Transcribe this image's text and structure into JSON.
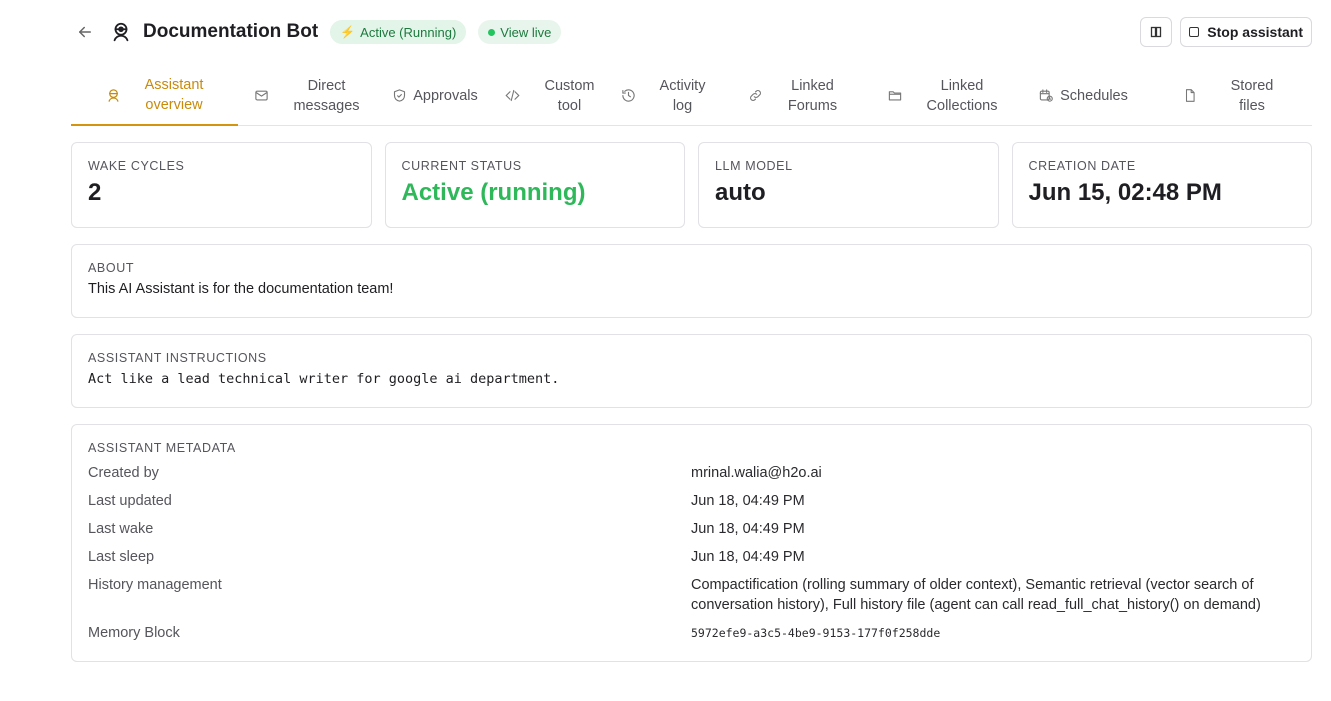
{
  "header": {
    "title": "Documentation Bot",
    "status_pill": "Active (Running)",
    "view_live": "View live",
    "stop_label": "Stop assistant"
  },
  "tabs": [
    {
      "label": "Assistant\noverview",
      "icon": "robot-icon",
      "active": true
    },
    {
      "label": "Direct\nmessages",
      "icon": "mail-icon"
    },
    {
      "label": "Approvals",
      "icon": "shield-check-icon"
    },
    {
      "label": "Custom\ntool",
      "icon": "code-icon"
    },
    {
      "label": "Activity\nlog",
      "icon": "history-icon"
    },
    {
      "label": "Linked\nForums",
      "icon": "link-icon"
    },
    {
      "label": "Linked\nCollections",
      "icon": "folder-icon"
    },
    {
      "label": "Schedules",
      "icon": "calendar-clock-icon"
    },
    {
      "label": "Stored\nfiles",
      "icon": "file-icon"
    }
  ],
  "stats": [
    {
      "label": "WAKE CYCLES",
      "value": "2"
    },
    {
      "label": "CURRENT STATUS",
      "value": "Active (running)"
    },
    {
      "label": "LLM MODEL",
      "value": "auto"
    },
    {
      "label": "CREATION DATE",
      "value": "Jun 15, 02:48 PM"
    }
  ],
  "about": {
    "label": "ABOUT",
    "text": "This AI Assistant is for the documentation team!"
  },
  "instructions": {
    "label": "ASSISTANT INSTRUCTIONS",
    "text": "Act like a lead technical writer for google ai department."
  },
  "metadata": {
    "label": "ASSISTANT METADATA",
    "rows": [
      {
        "key": "Created by",
        "value": "mrinal.walia@h2o.ai"
      },
      {
        "key": "Last updated",
        "value": "Jun 18, 04:49 PM"
      },
      {
        "key": "Last wake",
        "value": "Jun 18, 04:49 PM"
      },
      {
        "key": "Last sleep",
        "value": "Jun 18, 04:49 PM"
      },
      {
        "key": "History management",
        "value": "Compactification (rolling summary of older context), Semantic retrieval (vector search of conversation history), Full history file (agent can call read_full_chat_history() on demand)"
      },
      {
        "key": "Memory Block",
        "value": "5972efe9-a3c5-4be9-9153-177f0f258dde"
      }
    ]
  },
  "colors": {
    "accent": "#d4940f",
    "status_green": "#2fb85a"
  }
}
